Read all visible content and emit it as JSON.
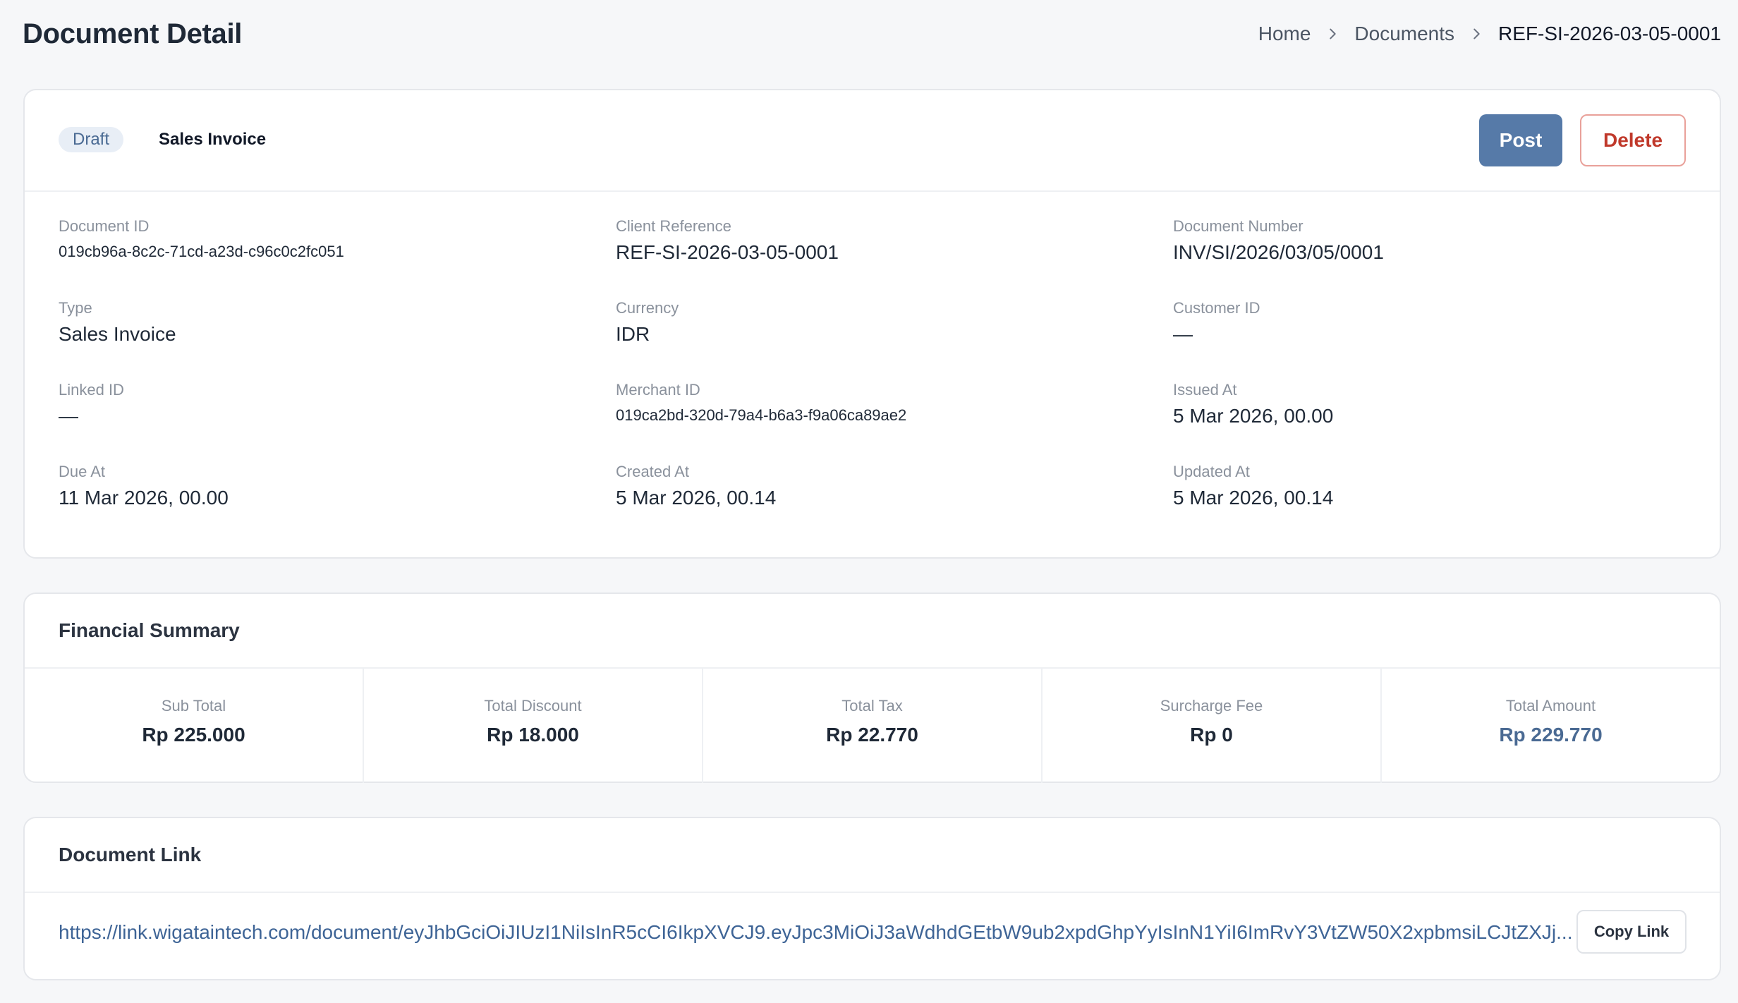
{
  "header": {
    "title": "Document Detail",
    "breadcrumb": [
      "Home",
      "Documents",
      "REF-SI-2026-03-05-0001"
    ]
  },
  "detail": {
    "status_badge": "Draft",
    "doc_type": "Sales Invoice",
    "actions": {
      "post": "Post",
      "delete": "Delete"
    },
    "fields": [
      {
        "label": "Document ID",
        "value": "019cb96a-8c2c-71cd-a23d-c96c0c2fc051"
      },
      {
        "label": "Client Reference",
        "value": "REF-SI-2026-03-05-0001"
      },
      {
        "label": "Document Number",
        "value": "INV/SI/2026/03/05/0001"
      },
      {
        "label": "Type",
        "value": "Sales Invoice"
      },
      {
        "label": "Currency",
        "value": "IDR"
      },
      {
        "label": "Customer ID",
        "value": "—"
      },
      {
        "label": "Linked ID",
        "value": "—"
      },
      {
        "label": "Merchant ID",
        "value": "019ca2bd-320d-79a4-b6a3-f9a06ca89ae2"
      },
      {
        "label": "Issued At",
        "value": "5 Mar 2026, 00.00"
      },
      {
        "label": "Due At",
        "value": "11 Mar 2026, 00.00"
      },
      {
        "label": "Created At",
        "value": "5 Mar 2026, 00.14"
      },
      {
        "label": "Updated At",
        "value": "5 Mar 2026, 00.14"
      }
    ]
  },
  "financial": {
    "title": "Financial Summary",
    "items": [
      {
        "label": "Sub Total",
        "value": "Rp 225.000"
      },
      {
        "label": "Total Discount",
        "value": "Rp 18.000"
      },
      {
        "label": "Total Tax",
        "value": "Rp 22.770"
      },
      {
        "label": "Surcharge Fee",
        "value": "Rp 0"
      },
      {
        "label": "Total Amount",
        "value": "Rp 229.770"
      }
    ]
  },
  "link": {
    "title": "Document Link",
    "url": "https://link.wigataintech.com/document/eyJhbGciOiJIUzI1NiIsInR5cCI6IkpXVCJ9.eyJpc3MiOiJ3aWdhdGEtbW9ub2xpdGhpYyIsInN1YiI6ImRvY3VtZW50X2xpbmsiLCJtZXJj...",
    "copy_label": "Copy Link"
  },
  "colors": {
    "accent": "#567aa8",
    "danger": "#c0392b",
    "badge_bg": "#e8eef6",
    "link": "#3e6496"
  }
}
